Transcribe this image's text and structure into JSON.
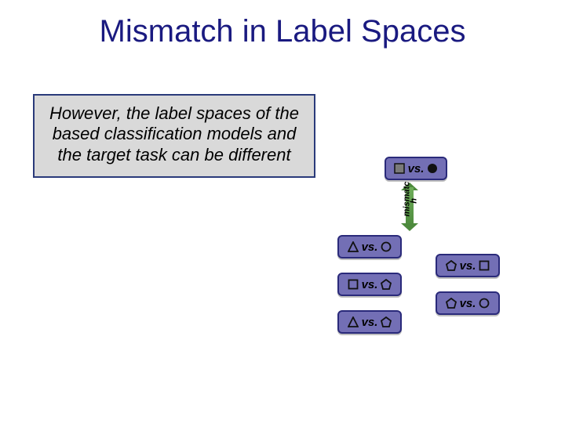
{
  "title": "Mismatch in Label Spaces",
  "callout": "However, the label spaces of the based classification models and the target task can be different",
  "vs": "vs.",
  "mismatch": "mismatc h",
  "top_box": {
    "left": "square-gray-filled",
    "right": "circle-black-filled"
  },
  "left_col": [
    {
      "left": "triangle-white",
      "right": "circle-white"
    },
    {
      "left": "square-white",
      "right": "pentagon-white"
    },
    {
      "left": "triangle-white",
      "right": "pentagon-white"
    }
  ],
  "right_col": [
    {
      "left": "pentagon-white",
      "right": "square-white"
    },
    {
      "left": "pentagon-white",
      "right": "circle-white"
    }
  ]
}
